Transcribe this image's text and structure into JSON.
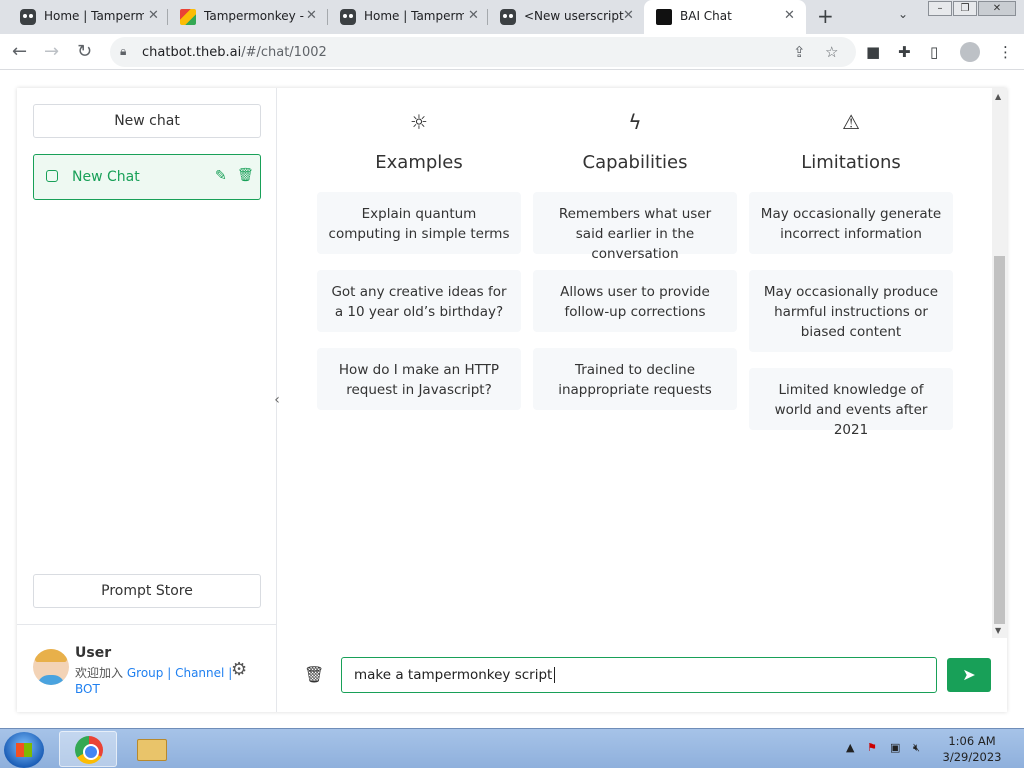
{
  "browser": {
    "tabs": [
      {
        "title": "Home | Tampermo",
        "icon": "tampermonkey-icon"
      },
      {
        "title": "Tampermonkey - ",
        "icon": "tampermonkey-color-icon"
      },
      {
        "title": "Home | Tamperm",
        "icon": "tampermonkey-icon"
      },
      {
        "title": "<New userscript>",
        "icon": "tampermonkey-icon"
      },
      {
        "title": "BAI Chat",
        "icon": "bai-icon"
      }
    ],
    "url_host": "chatbot.theb.ai",
    "url_path": "/#/chat/1002"
  },
  "sidebar": {
    "new_chat_button": "New chat",
    "chats": [
      {
        "label": "New Chat"
      }
    ],
    "prompt_store_button": "Prompt Store",
    "user": {
      "name": "User",
      "join_text": "欢迎加入",
      "group": "Group",
      "channel": "Channel",
      "bot": "BOT",
      "sep": "|"
    }
  },
  "main": {
    "columns": [
      {
        "heading": "Examples",
        "icon": "sun-icon",
        "cards": [
          "Explain quantum computing in simple terms",
          "Got any creative ideas for a 10 year old’s birthday?",
          "How do I make an HTTP request in Javascript?"
        ]
      },
      {
        "heading": "Capabilities",
        "icon": "lightning-icon",
        "cards": [
          "Remembers what user said earlier in the conversation",
          "Allows user to provide follow-up corrections",
          "Trained to decline inappropriate requests"
        ]
      },
      {
        "heading": "Limitations",
        "icon": "warning-icon",
        "cards": [
          "May occasionally generate incorrect information",
          "May occasionally produce harmful instructions or biased content",
          "Limited knowledge of world and events after 2021"
        ]
      }
    ],
    "input_value": "make a tampermonkey script"
  },
  "taskbar": {
    "time": "1:06 AM",
    "date": "3/29/2023"
  },
  "colors": {
    "accent": "#18a058",
    "link": "#2080f0"
  }
}
